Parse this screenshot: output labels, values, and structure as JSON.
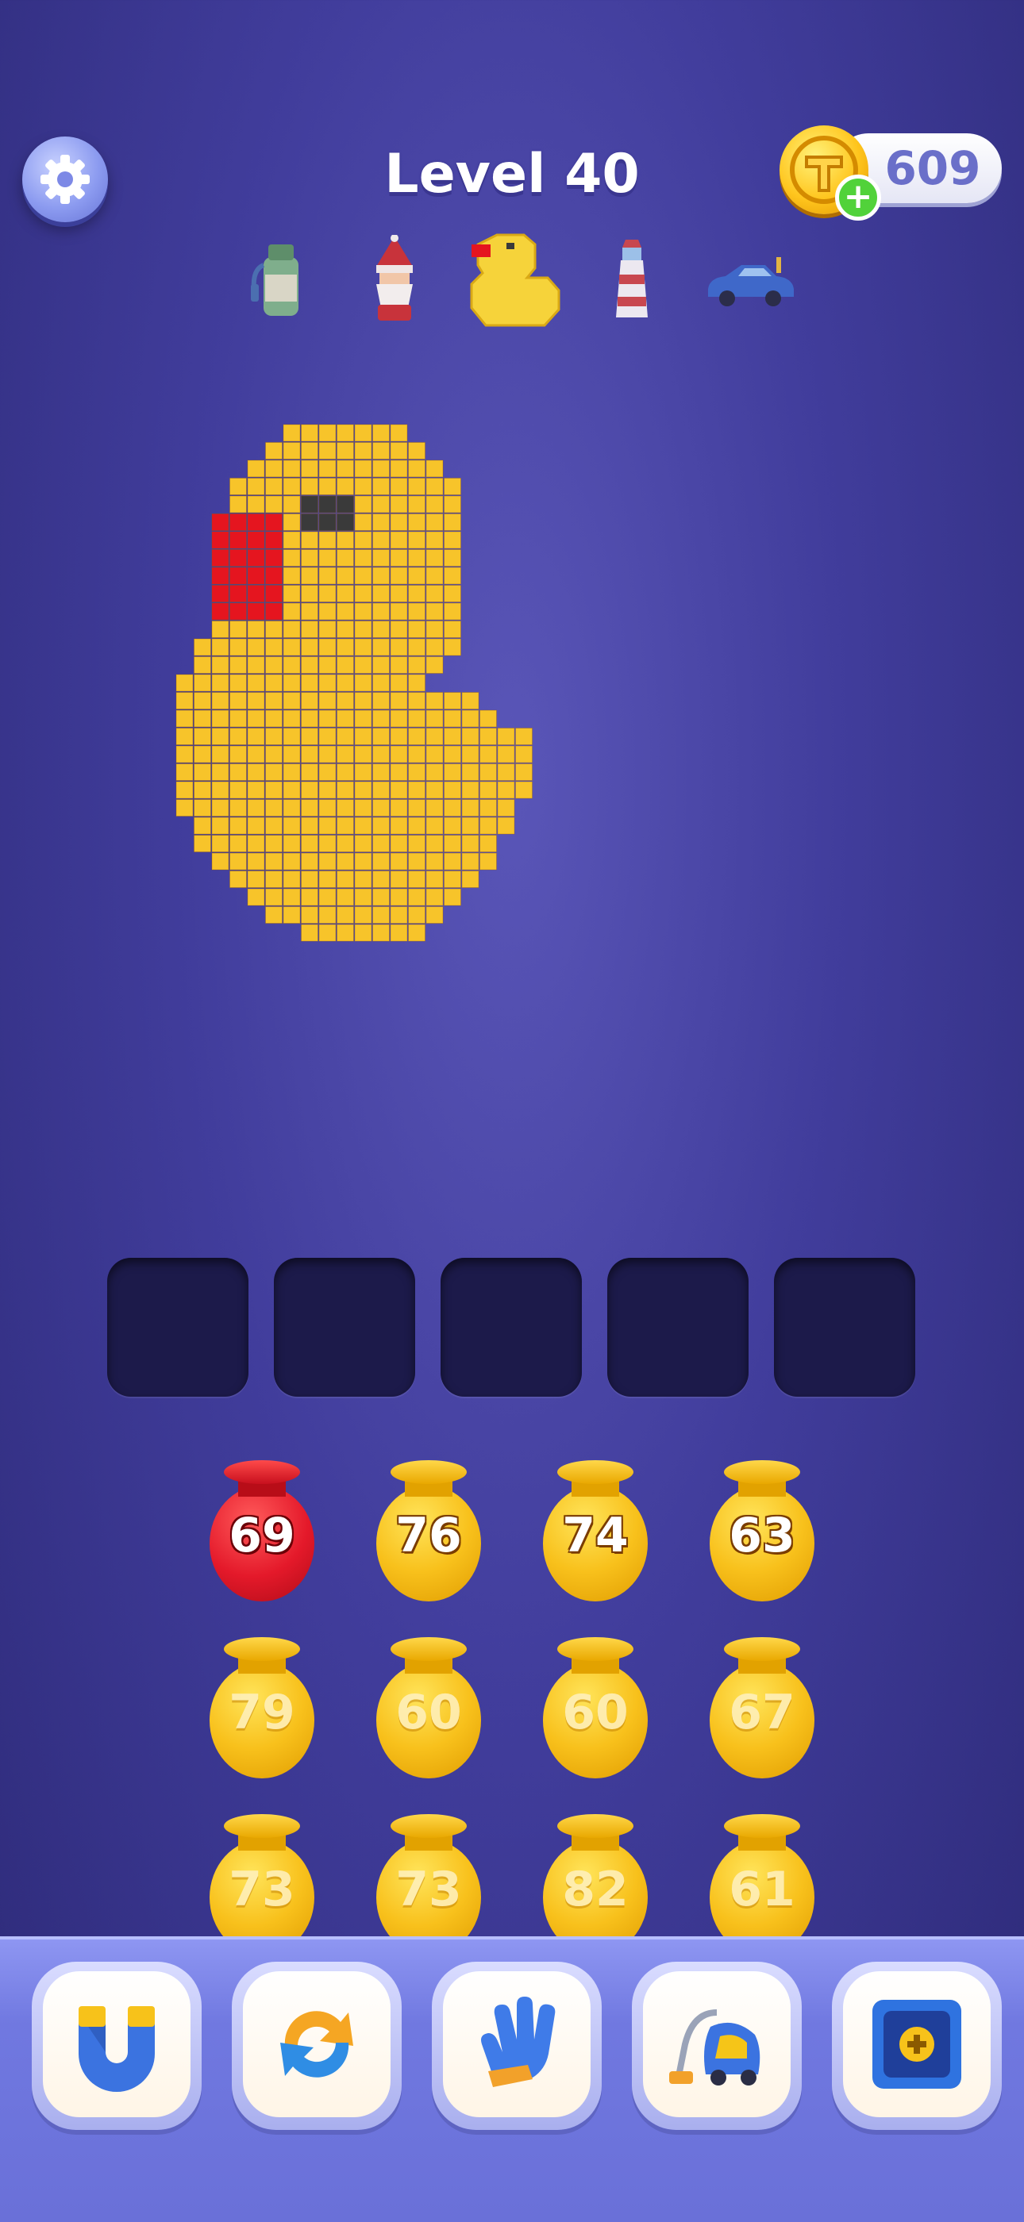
{
  "header": {
    "level_label": "Level 40",
    "coins": "609"
  },
  "icons": {
    "settings": "gear-icon",
    "coin": "coin-icon",
    "add_coins": "plus-icon"
  },
  "level_thumbnails": [
    {
      "name": "bottle-thumbnail",
      "state": "locked"
    },
    {
      "name": "santa-thumbnail",
      "state": "locked"
    },
    {
      "name": "duck-thumbnail",
      "state": "current"
    },
    {
      "name": "lighthouse-thumbnail",
      "state": "locked"
    },
    {
      "name": "car-thumbnail",
      "state": "locked"
    }
  ],
  "puzzle": {
    "subject": "rubber-duck",
    "colors": {
      "body": "#f7c42a",
      "beak": "#e5151f",
      "eye": "#3a3a3a"
    }
  },
  "slots": [
    {
      "filled": false
    },
    {
      "filled": false
    },
    {
      "filled": false
    },
    {
      "filled": false
    },
    {
      "filled": false
    }
  ],
  "jars": [
    [
      {
        "value": "69",
        "color": "red",
        "active": true
      },
      {
        "value": "76",
        "color": "yellow",
        "active": true
      },
      {
        "value": "74",
        "color": "yellow",
        "active": true
      },
      {
        "value": "63",
        "color": "yellow",
        "active": true
      }
    ],
    [
      {
        "value": "79",
        "color": "yellow",
        "active": false
      },
      {
        "value": "60",
        "color": "yellow",
        "active": false
      },
      {
        "value": "60",
        "color": "yellow",
        "active": false
      },
      {
        "value": "67",
        "color": "yellow",
        "active": false
      }
    ],
    [
      {
        "value": "73",
        "color": "yellow",
        "active": false
      },
      {
        "value": "73",
        "color": "yellow",
        "active": false
      },
      {
        "value": "82",
        "color": "yellow",
        "active": false
      },
      {
        "value": "61",
        "color": "yellow",
        "active": false
      }
    ]
  ],
  "tools": [
    {
      "name": "magnet-tool",
      "icon": "magnet-icon"
    },
    {
      "name": "shuffle-tool",
      "icon": "shuffle-icon"
    },
    {
      "name": "glove-tool",
      "icon": "glove-icon"
    },
    {
      "name": "vacuum-tool",
      "icon": "vacuum-icon"
    },
    {
      "name": "add-slot-tool",
      "icon": "add-slot-icon"
    }
  ]
}
